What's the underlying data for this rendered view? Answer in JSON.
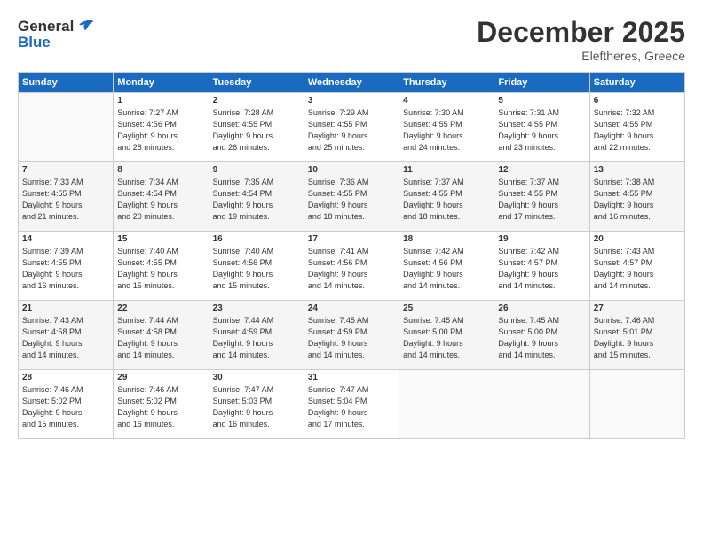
{
  "logo": {
    "line1": "General",
    "line2": "Blue"
  },
  "title": "December 2025",
  "location": "Eleftheres, Greece",
  "days_header": [
    "Sunday",
    "Monday",
    "Tuesday",
    "Wednesday",
    "Thursday",
    "Friday",
    "Saturday"
  ],
  "weeks": [
    [
      {
        "day": "",
        "info": ""
      },
      {
        "day": "1",
        "info": "Sunrise: 7:27 AM\nSunset: 4:56 PM\nDaylight: 9 hours\nand 28 minutes."
      },
      {
        "day": "2",
        "info": "Sunrise: 7:28 AM\nSunset: 4:55 PM\nDaylight: 9 hours\nand 26 minutes."
      },
      {
        "day": "3",
        "info": "Sunrise: 7:29 AM\nSunset: 4:55 PM\nDaylight: 9 hours\nand 25 minutes."
      },
      {
        "day": "4",
        "info": "Sunrise: 7:30 AM\nSunset: 4:55 PM\nDaylight: 9 hours\nand 24 minutes."
      },
      {
        "day": "5",
        "info": "Sunrise: 7:31 AM\nSunset: 4:55 PM\nDaylight: 9 hours\nand 23 minutes."
      },
      {
        "day": "6",
        "info": "Sunrise: 7:32 AM\nSunset: 4:55 PM\nDaylight: 9 hours\nand 22 minutes."
      }
    ],
    [
      {
        "day": "7",
        "info": "Sunrise: 7:33 AM\nSunset: 4:55 PM\nDaylight: 9 hours\nand 21 minutes."
      },
      {
        "day": "8",
        "info": "Sunrise: 7:34 AM\nSunset: 4:54 PM\nDaylight: 9 hours\nand 20 minutes."
      },
      {
        "day": "9",
        "info": "Sunrise: 7:35 AM\nSunset: 4:54 PM\nDaylight: 9 hours\nand 19 minutes."
      },
      {
        "day": "10",
        "info": "Sunrise: 7:36 AM\nSunset: 4:55 PM\nDaylight: 9 hours\nand 18 minutes."
      },
      {
        "day": "11",
        "info": "Sunrise: 7:37 AM\nSunset: 4:55 PM\nDaylight: 9 hours\nand 18 minutes."
      },
      {
        "day": "12",
        "info": "Sunrise: 7:37 AM\nSunset: 4:55 PM\nDaylight: 9 hours\nand 17 minutes."
      },
      {
        "day": "13",
        "info": "Sunrise: 7:38 AM\nSunset: 4:55 PM\nDaylight: 9 hours\nand 16 minutes."
      }
    ],
    [
      {
        "day": "14",
        "info": "Sunrise: 7:39 AM\nSunset: 4:55 PM\nDaylight: 9 hours\nand 16 minutes."
      },
      {
        "day": "15",
        "info": "Sunrise: 7:40 AM\nSunset: 4:55 PM\nDaylight: 9 hours\nand 15 minutes."
      },
      {
        "day": "16",
        "info": "Sunrise: 7:40 AM\nSunset: 4:56 PM\nDaylight: 9 hours\nand 15 minutes."
      },
      {
        "day": "17",
        "info": "Sunrise: 7:41 AM\nSunset: 4:56 PM\nDaylight: 9 hours\nand 14 minutes."
      },
      {
        "day": "18",
        "info": "Sunrise: 7:42 AM\nSunset: 4:56 PM\nDaylight: 9 hours\nand 14 minutes."
      },
      {
        "day": "19",
        "info": "Sunrise: 7:42 AM\nSunset: 4:57 PM\nDaylight: 9 hours\nand 14 minutes."
      },
      {
        "day": "20",
        "info": "Sunrise: 7:43 AM\nSunset: 4:57 PM\nDaylight: 9 hours\nand 14 minutes."
      }
    ],
    [
      {
        "day": "21",
        "info": "Sunrise: 7:43 AM\nSunset: 4:58 PM\nDaylight: 9 hours\nand 14 minutes."
      },
      {
        "day": "22",
        "info": "Sunrise: 7:44 AM\nSunset: 4:58 PM\nDaylight: 9 hours\nand 14 minutes."
      },
      {
        "day": "23",
        "info": "Sunrise: 7:44 AM\nSunset: 4:59 PM\nDaylight: 9 hours\nand 14 minutes."
      },
      {
        "day": "24",
        "info": "Sunrise: 7:45 AM\nSunset: 4:59 PM\nDaylight: 9 hours\nand 14 minutes."
      },
      {
        "day": "25",
        "info": "Sunrise: 7:45 AM\nSunset: 5:00 PM\nDaylight: 9 hours\nand 14 minutes."
      },
      {
        "day": "26",
        "info": "Sunrise: 7:45 AM\nSunset: 5:00 PM\nDaylight: 9 hours\nand 14 minutes."
      },
      {
        "day": "27",
        "info": "Sunrise: 7:46 AM\nSunset: 5:01 PM\nDaylight: 9 hours\nand 15 minutes."
      }
    ],
    [
      {
        "day": "28",
        "info": "Sunrise: 7:46 AM\nSunset: 5:02 PM\nDaylight: 9 hours\nand 15 minutes."
      },
      {
        "day": "29",
        "info": "Sunrise: 7:46 AM\nSunset: 5:02 PM\nDaylight: 9 hours\nand 16 minutes."
      },
      {
        "day": "30",
        "info": "Sunrise: 7:47 AM\nSunset: 5:03 PM\nDaylight: 9 hours\nand 16 minutes."
      },
      {
        "day": "31",
        "info": "Sunrise: 7:47 AM\nSunset: 5:04 PM\nDaylight: 9 hours\nand 17 minutes."
      },
      {
        "day": "",
        "info": ""
      },
      {
        "day": "",
        "info": ""
      },
      {
        "day": "",
        "info": ""
      }
    ]
  ]
}
